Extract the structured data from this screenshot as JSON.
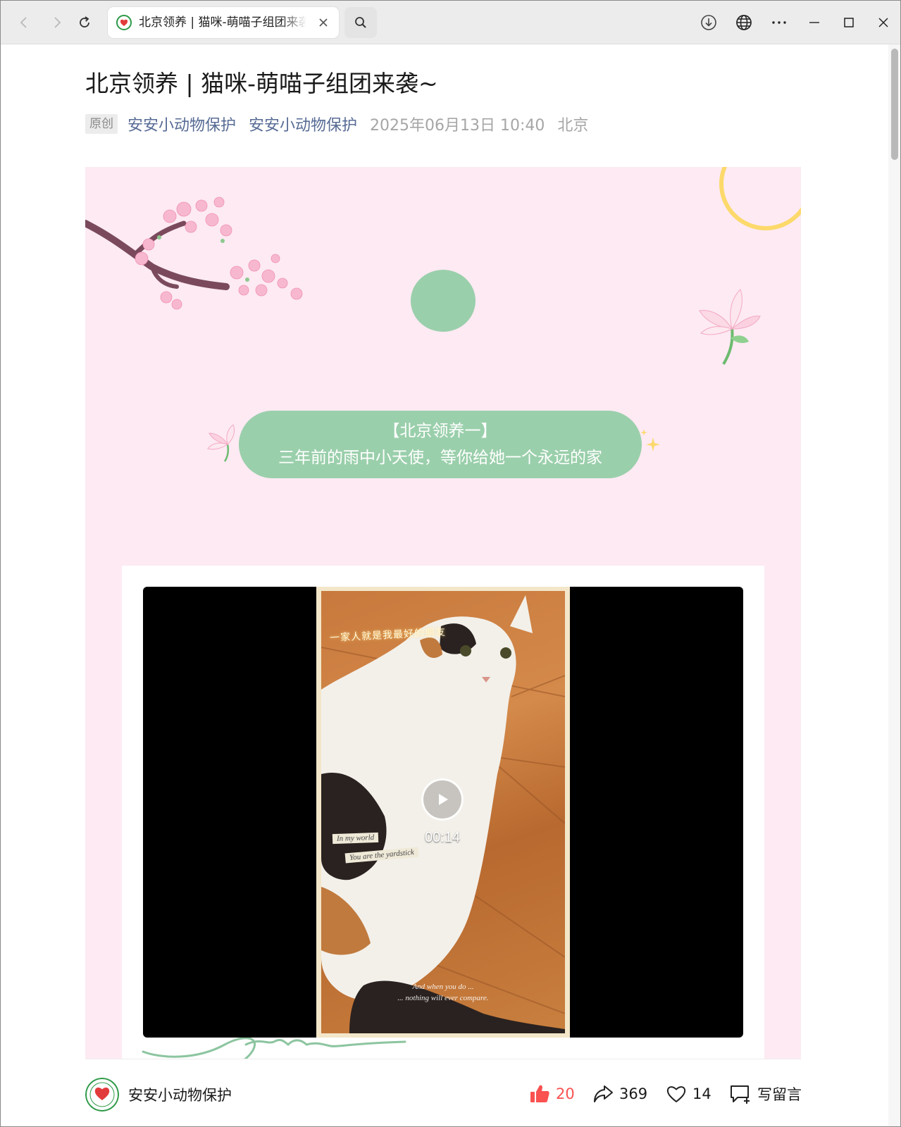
{
  "browser": {
    "tab_title": "北京领养 | 猫咪-萌喵子组团来袭~",
    "nav": {
      "back": "back",
      "forward": "forward",
      "reload": "reload"
    },
    "toolbar_icons": [
      "download-icon",
      "globe-icon",
      "more-icon",
      "minimize-icon",
      "maximize-icon",
      "close-icon"
    ]
  },
  "article": {
    "title": "北京领养 | 猫咪-萌喵子组团来袭~",
    "badge": "原创",
    "account_link_1": "安安小动物保护",
    "account_link_2": "安安小动物保护",
    "date": "2025年06月13日 10:40",
    "location": "北京"
  },
  "poster": {
    "pill_line1": "【北京领养一】",
    "pill_line2": "三年前的雨中小天使，等你给她一个永远的家",
    "video": {
      "duration": "00:14",
      "frame_topline": "一家人就是我最好的朋友",
      "tape_1": "In my world",
      "tape_2": "You are the yardstick",
      "caption_1": "And when you do ...",
      "caption_2": "... nothing will ever compare."
    }
  },
  "footer": {
    "account_name": "安安小动物保护",
    "likes": "20",
    "shares": "369",
    "favorites": "14",
    "comment_label": "写留言"
  },
  "colors": {
    "accent_link": "#576b95",
    "poster_bg": "#fdeaf3",
    "pill_green": "#9acfab",
    "like_red": "#fa5151"
  }
}
